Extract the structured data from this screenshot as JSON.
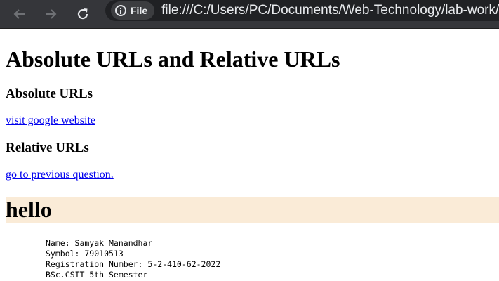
{
  "browser": {
    "site_chip_label": "File",
    "url": "file:///C:/Users/PC/Documents/Web-Technology/lab-work/html"
  },
  "page": {
    "title": "Absolute URLs and Relative URLs",
    "absolute_heading": "Absolute URLs",
    "absolute_link": "visit google website",
    "relative_heading": "Relative URLs",
    "relative_link": "go to previous question.",
    "hello": "hello",
    "info_lines": [
      "Name: Samyak Manandhar",
      "Symbol: 79010513",
      "Registration Number: 5-2-410-62-2022",
      "BSc.CSIT 5th Semester"
    ]
  },
  "colors": {
    "toolbar": "#35363a",
    "omnibox": "#202124",
    "link": "#0000ee",
    "hello_background": "#faebd7"
  }
}
